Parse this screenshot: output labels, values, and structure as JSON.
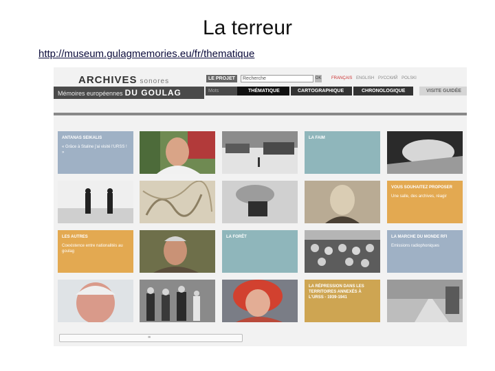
{
  "slide": {
    "title": "La terreur",
    "link": "http://museum.gulagmemories.eu/fr/thematique"
  },
  "site": {
    "logo_line1": "ARCHIVES",
    "logo_line1_sub": "sonores",
    "logo_line2": "Mémoires européennes",
    "logo_line2_big": "DU GOULAG",
    "projet_label": "LE PROJET",
    "search_value": "Recherche",
    "search_button": "OK",
    "languages": [
      "FRANÇAIS",
      "ENGLISH",
      "РУССКИЙ",
      "POLSKI"
    ],
    "active_language": "FRANÇAIS",
    "menu": {
      "placeholder": "Mots",
      "thematique": "THÉMATIQUE",
      "cartographique": "CARTOGRAPHIQUE",
      "chronologique": "CHRONOLOGIQUE",
      "visite": "VISITE GUIDÉE"
    },
    "tiles": {
      "t1": {
        "title": "ANTANAS SEIKALIS",
        "desc": "« Grâce à Staline j'ai visité l'URSS ! »"
      },
      "t2": {
        "title": "LA FAIM"
      },
      "t3": {
        "title": "VOUS SOUHAITEZ PROPOSER",
        "desc": "Une salle, des archives, réagir"
      },
      "t4": {
        "title": "LES AUTRES",
        "desc": "Coexistence entre nationalités au goulag"
      },
      "t5": {
        "title": "LA FORÊT"
      },
      "t6": {
        "title": "LA MARCHE DU MONDE RFI",
        "desc": "Emissions radiophoniques"
      },
      "t7": {
        "title": "LA RÉPRESSION DANS LES TERRITOIRES ANNEXÉS À L'URSS - 1939-1941"
      }
    },
    "scroll_glyph": "≡",
    "colors": {
      "blue": "#9fb1c5",
      "teal": "#8fb6bb",
      "orange": "#e3a951",
      "gold": "#cea552"
    }
  }
}
